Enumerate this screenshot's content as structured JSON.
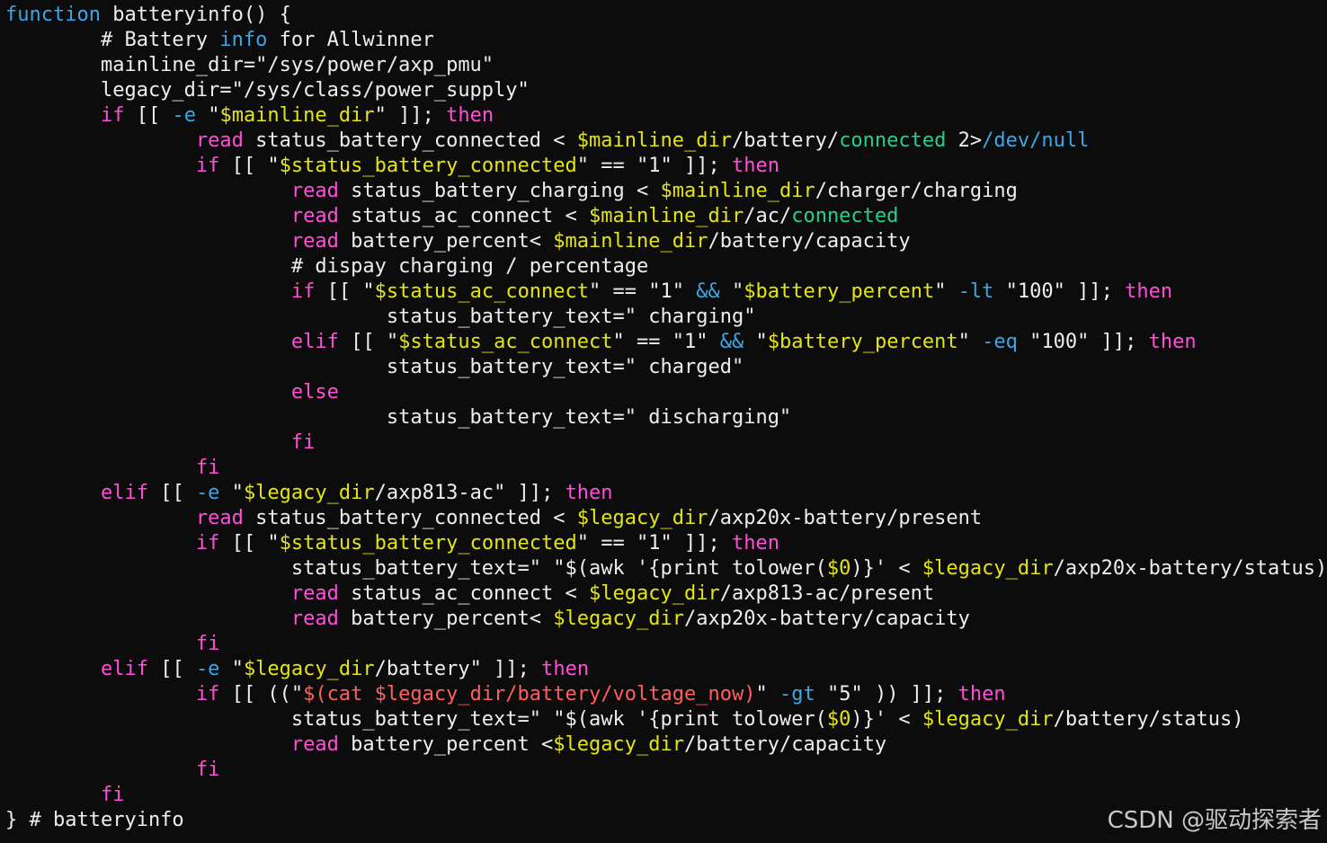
{
  "colors": {
    "background": "#0c0c0c",
    "default": "#eeeeee",
    "keyword": "#ff4fd8",
    "variable": "#e5e510",
    "builtin": "#3aa8e8",
    "string_sub": "#ff5f5f",
    "green": "#23d18b",
    "watermark": "#c8c8c8"
  },
  "watermark": "CSDN @驱动探索者",
  "code_lines": [
    [
      [
        "builtin",
        "function"
      ],
      [
        "n",
        " batteryinfo() {"
      ]
    ],
    [
      [
        "n",
        "        # Battery "
      ],
      [
        "builtin",
        "info"
      ],
      [
        "n",
        " for Allwinner"
      ]
    ],
    [
      [
        "n",
        "        mainline_dir=\"/sys/power/axp_pmu\""
      ]
    ],
    [
      [
        "n",
        "        legacy_dir=\"/sys/class/power_supply\""
      ]
    ],
    [
      [
        "n",
        "        "
      ],
      [
        "keyword",
        "if"
      ],
      [
        "n",
        " [[ "
      ],
      [
        "builtin",
        "-e"
      ],
      [
        "n",
        " \""
      ],
      [
        "variable",
        "$mainline_dir"
      ],
      [
        "n",
        "\" ]]; "
      ],
      [
        "keyword",
        "then"
      ]
    ],
    [
      [
        "n",
        "                "
      ],
      [
        "keyword",
        "read"
      ],
      [
        "n",
        " status_battery_connected < "
      ],
      [
        "variable",
        "$mainline_dir"
      ],
      [
        "n",
        "/battery/"
      ],
      [
        "green",
        "connected"
      ],
      [
        "n",
        " 2>"
      ],
      [
        "builtin",
        "/dev/null"
      ]
    ],
    [
      [
        "n",
        "                "
      ],
      [
        "keyword",
        "if"
      ],
      [
        "n",
        " [[ \""
      ],
      [
        "variable",
        "$status_battery_connected"
      ],
      [
        "n",
        "\" == \"1\" ]]; "
      ],
      [
        "keyword",
        "then"
      ]
    ],
    [
      [
        "n",
        "                        "
      ],
      [
        "keyword",
        "read"
      ],
      [
        "n",
        " status_battery_charging < "
      ],
      [
        "variable",
        "$mainline_dir"
      ],
      [
        "n",
        "/charger/charging"
      ]
    ],
    [
      [
        "n",
        "                        "
      ],
      [
        "keyword",
        "read"
      ],
      [
        "n",
        " status_ac_connect < "
      ],
      [
        "variable",
        "$mainline_dir"
      ],
      [
        "n",
        "/ac/"
      ],
      [
        "green",
        "connected"
      ]
    ],
    [
      [
        "n",
        "                        "
      ],
      [
        "keyword",
        "read"
      ],
      [
        "n",
        " battery_percent< "
      ],
      [
        "variable",
        "$mainline_dir"
      ],
      [
        "n",
        "/battery/capacity"
      ]
    ],
    [
      [
        "n",
        "                        # dispay charging / percentage"
      ]
    ],
    [
      [
        "n",
        "                        "
      ],
      [
        "keyword",
        "if"
      ],
      [
        "n",
        " [[ \""
      ],
      [
        "variable",
        "$status_ac_connect"
      ],
      [
        "n",
        "\" == \"1\" "
      ],
      [
        "builtin",
        "&&"
      ],
      [
        "n",
        " \""
      ],
      [
        "variable",
        "$battery_percent"
      ],
      [
        "n",
        "\" "
      ],
      [
        "builtin",
        "-lt"
      ],
      [
        "n",
        " \"100\" ]]; "
      ],
      [
        "keyword",
        "then"
      ]
    ],
    [
      [
        "n",
        "                                status_battery_text=\" charging\""
      ]
    ],
    [
      [
        "n",
        "                        "
      ],
      [
        "keyword",
        "elif"
      ],
      [
        "n",
        " [[ \""
      ],
      [
        "variable",
        "$status_ac_connect"
      ],
      [
        "n",
        "\" == \"1\" "
      ],
      [
        "builtin",
        "&&"
      ],
      [
        "n",
        " \""
      ],
      [
        "variable",
        "$battery_percent"
      ],
      [
        "n",
        "\" "
      ],
      [
        "builtin",
        "-eq"
      ],
      [
        "n",
        " \"100\" ]]; "
      ],
      [
        "keyword",
        "then"
      ]
    ],
    [
      [
        "n",
        "                                status_battery_text=\" charged\""
      ]
    ],
    [
      [
        "n",
        "                        "
      ],
      [
        "keyword",
        "else"
      ]
    ],
    [
      [
        "n",
        "                                status_battery_text=\" discharging\""
      ]
    ],
    [
      [
        "n",
        "                        "
      ],
      [
        "keyword",
        "fi"
      ]
    ],
    [
      [
        "n",
        "                "
      ],
      [
        "keyword",
        "fi"
      ]
    ],
    [
      [
        "n",
        "        "
      ],
      [
        "keyword",
        "elif"
      ],
      [
        "n",
        " [[ "
      ],
      [
        "builtin",
        "-e"
      ],
      [
        "n",
        " \""
      ],
      [
        "variable",
        "$legacy_dir"
      ],
      [
        "n",
        "/axp813-ac\" ]]; "
      ],
      [
        "keyword",
        "then"
      ]
    ],
    [
      [
        "n",
        "                "
      ],
      [
        "keyword",
        "read"
      ],
      [
        "n",
        " status_battery_connected < "
      ],
      [
        "variable",
        "$legacy_dir"
      ],
      [
        "n",
        "/axp20x-battery/present"
      ]
    ],
    [
      [
        "n",
        "                "
      ],
      [
        "keyword",
        "if"
      ],
      [
        "n",
        " [[ \""
      ],
      [
        "variable",
        "$status_battery_connected"
      ],
      [
        "n",
        "\" == \"1\" ]]; "
      ],
      [
        "keyword",
        "then"
      ]
    ],
    [
      [
        "n",
        "                        status_battery_text=\" \"$(awk '{print tolower("
      ],
      [
        "variable",
        "$0"
      ],
      [
        "n",
        ")}' < "
      ],
      [
        "variable",
        "$legacy_dir"
      ],
      [
        "n",
        "/axp20x-battery/status)"
      ]
    ],
    [
      [
        "n",
        "                        "
      ],
      [
        "keyword",
        "read"
      ],
      [
        "n",
        " status_ac_connect < "
      ],
      [
        "variable",
        "$legacy_dir"
      ],
      [
        "n",
        "/axp813-ac/present"
      ]
    ],
    [
      [
        "n",
        "                        "
      ],
      [
        "keyword",
        "read"
      ],
      [
        "n",
        " battery_percent< "
      ],
      [
        "variable",
        "$legacy_dir"
      ],
      [
        "n",
        "/axp20x-battery/capacity"
      ]
    ],
    [
      [
        "n",
        "                "
      ],
      [
        "keyword",
        "fi"
      ]
    ],
    [
      [
        "n",
        "        "
      ],
      [
        "keyword",
        "elif"
      ],
      [
        "n",
        " [[ "
      ],
      [
        "builtin",
        "-e"
      ],
      [
        "n",
        " \""
      ],
      [
        "variable",
        "$legacy_dir"
      ],
      [
        "n",
        "/battery\" ]]; "
      ],
      [
        "keyword",
        "then"
      ]
    ],
    [
      [
        "n",
        "                "
      ],
      [
        "keyword",
        "if"
      ],
      [
        "n",
        " [[ ((\""
      ],
      [
        "string_sub",
        "$(cat $legacy_dir/battery/voltage_now)"
      ],
      [
        "n",
        "\" "
      ],
      [
        "builtin",
        "-gt"
      ],
      [
        "n",
        " \"5\" )) ]]; "
      ],
      [
        "keyword",
        "then"
      ]
    ],
    [
      [
        "n",
        "                        status_battery_text=\" \"$(awk '{print tolower("
      ],
      [
        "variable",
        "$0"
      ],
      [
        "n",
        ")}' < "
      ],
      [
        "variable",
        "$legacy_dir"
      ],
      [
        "n",
        "/battery/status)"
      ]
    ],
    [
      [
        "n",
        "                        "
      ],
      [
        "keyword",
        "read"
      ],
      [
        "n",
        " battery_percent <"
      ],
      [
        "variable",
        "$legacy_dir"
      ],
      [
        "n",
        "/battery/capacity"
      ]
    ],
    [
      [
        "n",
        "                "
      ],
      [
        "keyword",
        "fi"
      ]
    ],
    [
      [
        "n",
        "        "
      ],
      [
        "keyword",
        "fi"
      ]
    ],
    [
      [
        "n",
        "} # batteryinfo"
      ]
    ]
  ]
}
